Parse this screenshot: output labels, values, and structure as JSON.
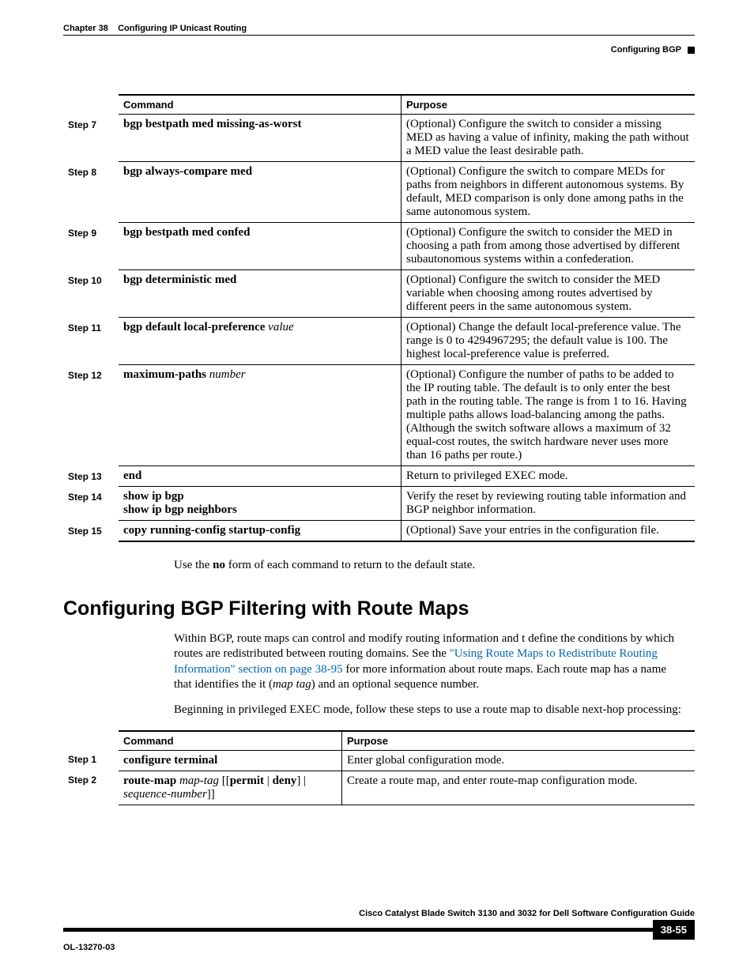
{
  "header": {
    "chapter": "Chapter 38",
    "title": "Configuring IP Unicast Routing",
    "section": "Configuring BGP"
  },
  "table1": {
    "cols": {
      "command": "Command",
      "purpose": "Purpose"
    },
    "rows": [
      {
        "step": "Step 7",
        "cmd_b": "bgp bestpath med missing-as-worst",
        "cmd_i": "",
        "purpose": "(Optional) Configure the switch to consider a missing MED as having a value of infinity, making the path without a MED value the least desirable path."
      },
      {
        "step": "Step 8",
        "cmd_b": "bgp always-compare med",
        "cmd_i": "",
        "purpose": "(Optional) Configure the switch to compare MEDs for paths from neighbors in different autonomous systems. By default, MED comparison is only done among paths in the same autonomous system."
      },
      {
        "step": "Step 9",
        "cmd_b": "bgp bestpath med confed",
        "cmd_i": "",
        "purpose": "(Optional) Configure the switch to consider the MED in choosing a path from among those advertised by different subautonomous systems within a confederation."
      },
      {
        "step": "Step 10",
        "cmd_b": "bgp deterministic med",
        "cmd_i": "",
        "purpose": "(Optional) Configure the switch to consider the MED variable when choosing among routes advertised by different peers in the same autonomous system."
      },
      {
        "step": "Step 11",
        "cmd_b": "bgp default local-preference",
        "cmd_i": "value",
        "purpose": "(Optional) Change the default local-preference value. The range is 0 to 4294967295; the default value is 100. The highest local-preference value is preferred."
      },
      {
        "step": "Step 12",
        "cmd_b": "maximum-paths",
        "cmd_i": "number",
        "purpose": "(Optional) Configure the number of paths to be added to the IP routing table. The default is to only enter the best path in the routing table. The range is from 1 to 16. Having multiple paths allows load-balancing among the paths. (Although the switch software allows a maximum of 32 equal-cost routes, the switch hardware never uses more than 16 paths per route.)"
      },
      {
        "step": "Step 13",
        "cmd_b": "end",
        "cmd_i": "",
        "purpose": "Return to privileged EXEC mode."
      },
      {
        "step": "Step 14",
        "cmd_b": "show ip bgp",
        "cmd_b2": "show ip bgp neighbors",
        "purpose": "Verify the reset by reviewing routing table information and BGP neighbor information."
      },
      {
        "step": "Step 15",
        "cmd_b": "copy running-config startup-config",
        "cmd_i": "",
        "purpose": "(Optional) Save your entries in the configuration file."
      }
    ]
  },
  "note": {
    "pre": "Use the ",
    "b": "no",
    "post": " form of each command to return to the default state."
  },
  "h2": "Configuring BGP Filtering with Route Maps",
  "para1": {
    "pre": "Within BGP, route maps can control and modify routing information and t define the conditions by which routes are redistributed between routing domains. See the ",
    "link": "\"Using Route Maps to Redistribute Routing Information\" section on page 38-95",
    "mid": " for more information about route maps. Each route map has a name that identifies the it (",
    "i": "map tag",
    "post": ") and an optional sequence number."
  },
  "para2": "Beginning in privileged EXEC mode, follow these steps to use a route map to disable next-hop processing:",
  "table2": {
    "cols": {
      "command": "Command",
      "purpose": "Purpose"
    },
    "rows": [
      {
        "step": "Step 1",
        "cmd": "configure terminal",
        "purpose": "Enter global configuration mode."
      },
      {
        "step": "Step 2",
        "cmd_html": true,
        "cmd_b1": "route-map",
        "cmd_i1": "map-tag",
        "cmd_t1": " [[",
        "cmd_b2": "permit",
        "cmd_t2": " | ",
        "cmd_b3": "deny",
        "cmd_t3": "] | ",
        "cmd_i2": "sequence-number",
        "cmd_t4": "]]",
        "purpose": "Create a route map, and enter route-map configuration mode."
      }
    ]
  },
  "footer": {
    "guide": "Cisco Catalyst Blade Switch 3130 and 3032 for Dell Software Configuration Guide",
    "doc": "OL-13270-03",
    "page": "38-55"
  }
}
